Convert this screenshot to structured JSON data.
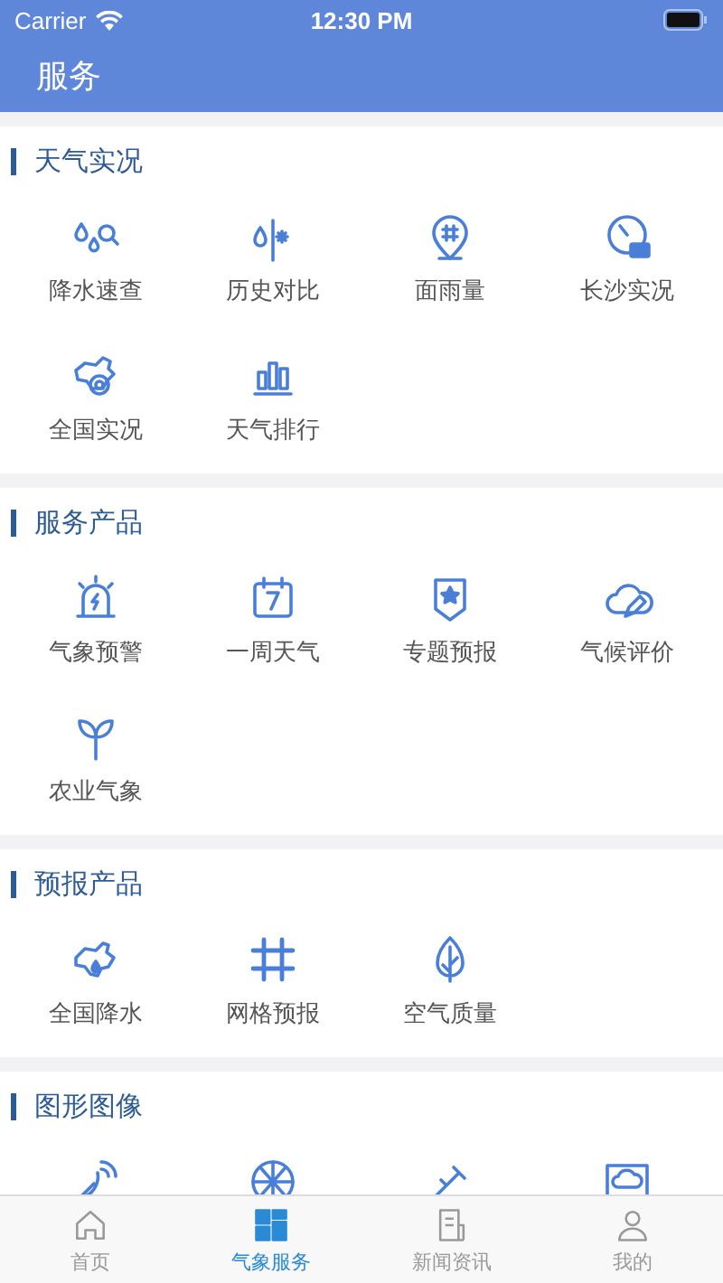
{
  "status_bar": {
    "carrier": "Carrier",
    "time": "12:30 PM"
  },
  "nav_bar": {
    "title": "服务"
  },
  "sections": [
    {
      "title": "天气实况",
      "items": [
        {
          "label": "降水速查"
        },
        {
          "label": "历史对比"
        },
        {
          "label": "面雨量"
        },
        {
          "label": "长沙实况"
        },
        {
          "label": "全国实况"
        },
        {
          "label": "天气排行"
        }
      ]
    },
    {
      "title": "服务产品",
      "items": [
        {
          "label": "气象预警"
        },
        {
          "label": "一周天气"
        },
        {
          "label": "专题预报"
        },
        {
          "label": "气候评价"
        },
        {
          "label": "农业气象"
        }
      ]
    },
    {
      "title": "预报产品",
      "items": [
        {
          "label": "全国降水"
        },
        {
          "label": "网格预报"
        },
        {
          "label": "空气质量"
        }
      ]
    },
    {
      "title": "图形图像"
    }
  ],
  "tab_bar": [
    {
      "label": "首页",
      "selected": false
    },
    {
      "label": "气象服务",
      "selected": true
    },
    {
      "label": "新闻资讯",
      "selected": false
    },
    {
      "label": "我的",
      "selected": false
    }
  ]
}
